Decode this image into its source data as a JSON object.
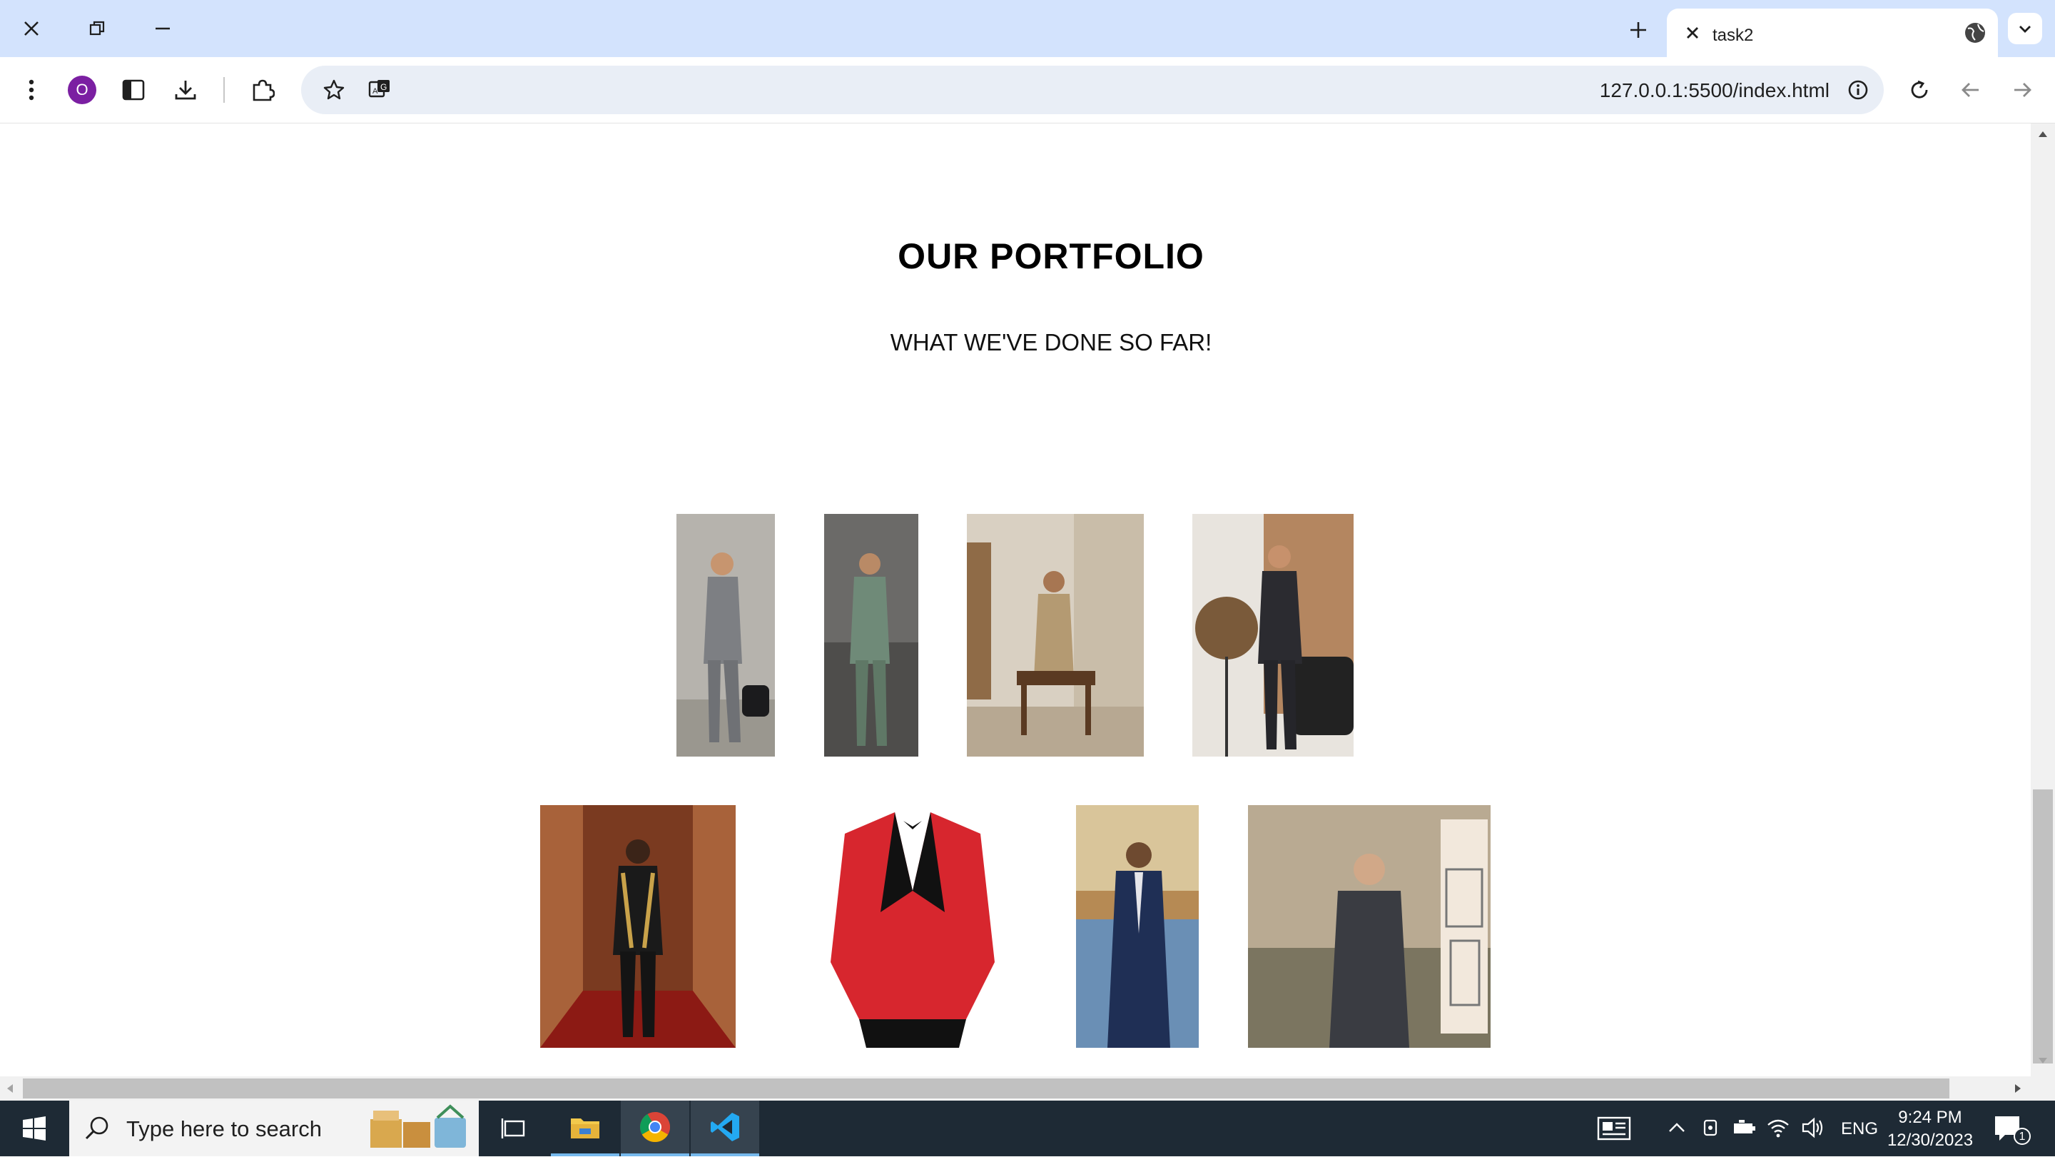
{
  "browser": {
    "tab_title": "task2",
    "url": "127.0.0.1:5500/index.html",
    "profile_initial": "O"
  },
  "page": {
    "title": "OUR PORTFOLIO",
    "subtitle": "WHAT WE'VE DONE SO FAR!",
    "photos": [
      {
        "name": "man in grey three-piece suit carrying duffel bag on street",
        "suit": "#7d7f83",
        "bg": "#b6b3ad"
      },
      {
        "name": "man in sage green suit on cobblestone street",
        "suit": "#6f8a78",
        "bg": "#6b6a68"
      },
      {
        "name": "man in beige suit seated in hallway",
        "suit": "#b49a72",
        "bg": "#d9d0c2"
      },
      {
        "name": "man in dark suit next to lamp and armchair",
        "suit": "#2b2b30",
        "bg": "#b48660"
      },
      {
        "name": "man in black and gold tuxedo in red hotel corridor",
        "suit": "#1a1a1a",
        "bg": "#7a3a20"
      },
      {
        "name": "red tuxedo jacket with black lapels",
        "suit": "#d7262e",
        "bg": "#ffffff"
      },
      {
        "name": "man in navy pinstripe suit by waterfront",
        "suit": "#1f2f55",
        "bg": "#6a8fb5"
      },
      {
        "name": "man in charcoal three-piece suit with sketch panel",
        "suit": "#3a3c42",
        "bg": "#b9aa92"
      }
    ]
  },
  "taskbar": {
    "search_placeholder": "Type here to search",
    "language": "ENG",
    "time": "9:24 PM",
    "date": "12/30/2023",
    "notification_count": "1"
  }
}
